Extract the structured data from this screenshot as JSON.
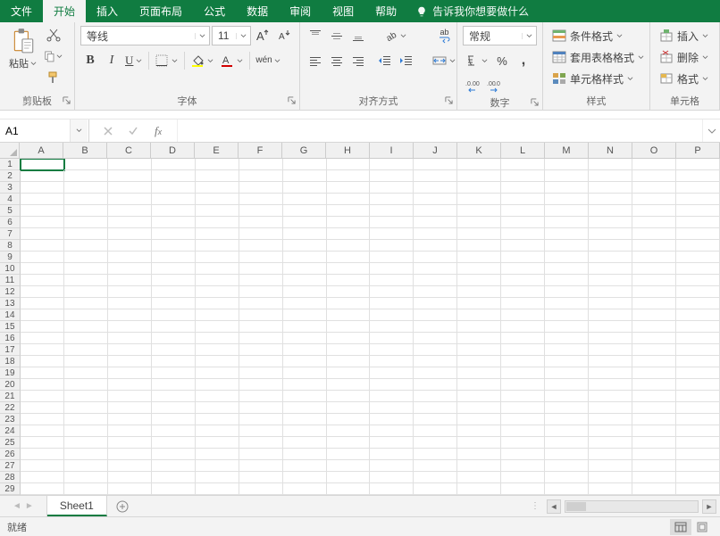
{
  "menu": {
    "tabs": [
      "文件",
      "开始",
      "插入",
      "页面布局",
      "公式",
      "数据",
      "审阅",
      "视图",
      "帮助"
    ],
    "active": 1,
    "tell_me": "告诉我你想要做什么"
  },
  "ribbon": {
    "clipboard": {
      "paste": "粘贴",
      "label": "剪贴板"
    },
    "font": {
      "name": "等线",
      "size": "11",
      "label": "字体",
      "wen": "wén"
    },
    "align": {
      "label": "对齐方式",
      "wrap_char": "ab"
    },
    "number": {
      "format": "常规",
      "label": "数字"
    },
    "styles": {
      "cond": "条件格式",
      "table": "套用表格格式",
      "cell": "单元格样式",
      "label": "样式"
    },
    "cells": {
      "insert": "插入",
      "delete": "删除",
      "format": "格式",
      "label": "单元格"
    }
  },
  "namebox": "A1",
  "columns": [
    "A",
    "B",
    "C",
    "D",
    "E",
    "F",
    "G",
    "H",
    "I",
    "J",
    "K",
    "L",
    "M",
    "N",
    "O",
    "P"
  ],
  "rowcount": 29,
  "sheet": {
    "name": "Sheet1"
  },
  "status": {
    "ready": "就绪"
  }
}
